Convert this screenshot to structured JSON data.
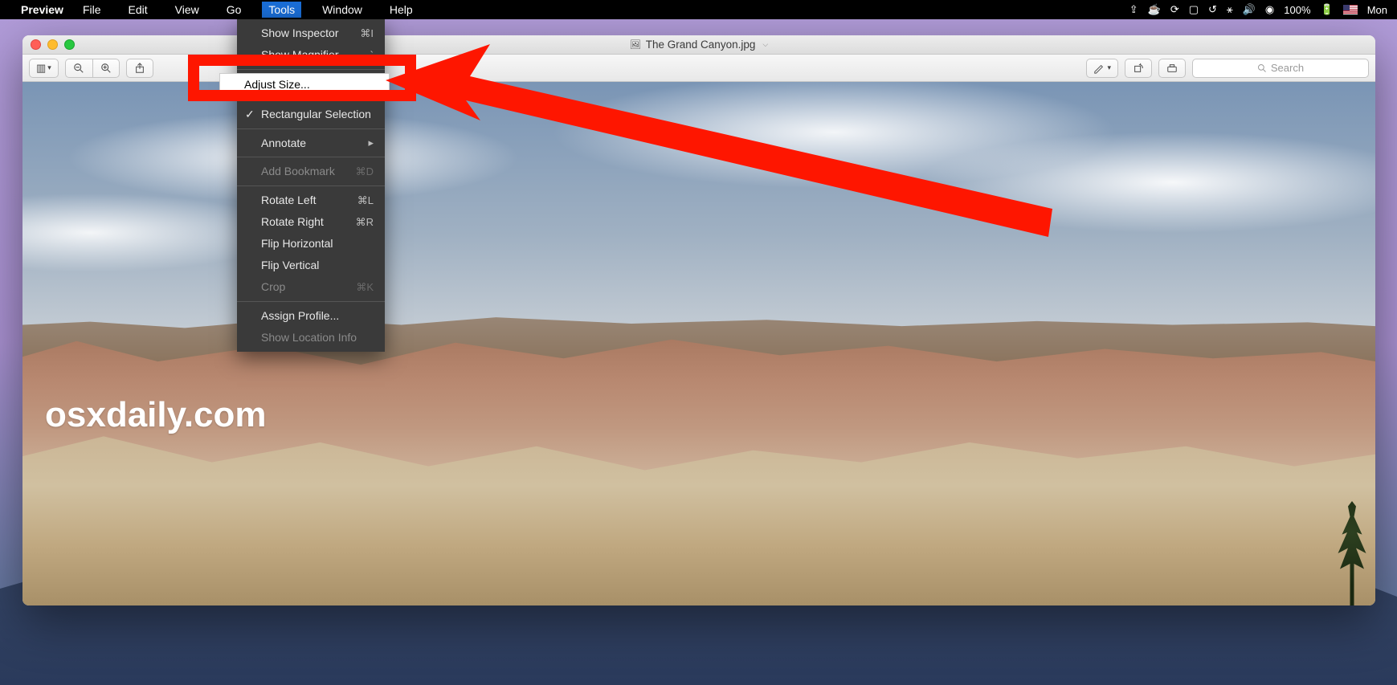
{
  "menubar": {
    "app_name": "Preview",
    "items": [
      "File",
      "Edit",
      "View",
      "Go",
      "Tools",
      "Window",
      "Help"
    ],
    "active_index": 4,
    "battery_pct": "100%",
    "day": "Mon"
  },
  "dropdown": {
    "items": [
      {
        "label": "Show Inspector",
        "shortcut": "⌘I",
        "disabled": false
      },
      {
        "label": "Show Magnifier",
        "shortcut": "`",
        "disabled": false
      },
      {
        "sep": true
      },
      {
        "label": "Adjust Size...",
        "shortcut": "",
        "highlight": true
      },
      {
        "sep": true
      },
      {
        "label": "Rectangular Selection",
        "shortcut": "",
        "checked": true
      },
      {
        "sep": true
      },
      {
        "label": "Annotate",
        "shortcut": "▸",
        "submenu": true
      },
      {
        "sep": true
      },
      {
        "label": "Add Bookmark",
        "shortcut": "⌘D",
        "disabled": true
      },
      {
        "sep": true
      },
      {
        "label": "Rotate Left",
        "shortcut": "⌘L"
      },
      {
        "label": "Rotate Right",
        "shortcut": "⌘R"
      },
      {
        "label": "Flip Horizontal",
        "shortcut": ""
      },
      {
        "label": "Flip Vertical",
        "shortcut": ""
      },
      {
        "label": "Crop",
        "shortcut": "⌘K",
        "disabled": true
      },
      {
        "sep": true
      },
      {
        "label": "Assign Profile...",
        "shortcut": ""
      },
      {
        "label": "Show Location Info",
        "shortcut": "",
        "disabled": true
      }
    ]
  },
  "window": {
    "title": "The Grand Canyon.jpg",
    "search_placeholder": "Search"
  },
  "watermark": "osxdaily.com"
}
